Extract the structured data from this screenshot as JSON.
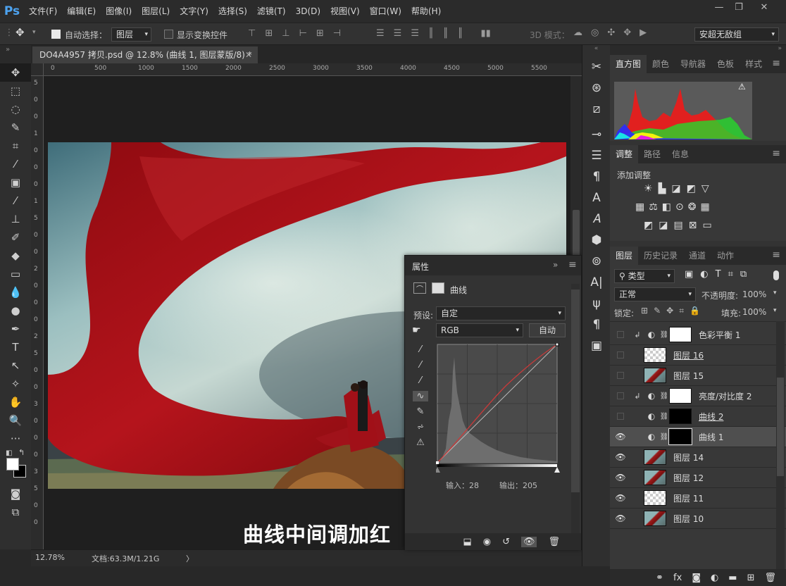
{
  "app": {
    "logo": "Ps",
    "accent": "#4da3f0"
  },
  "menu": [
    "文件(F)",
    "编辑(E)",
    "图像(I)",
    "图层(L)",
    "文字(Y)",
    "选择(S)",
    "滤镜(T)",
    "3D(D)",
    "视图(V)",
    "窗口(W)",
    "帮助(H)"
  ],
  "window_controls": [
    "—",
    "❐",
    "✕"
  ],
  "options": {
    "auto_select_label": "自动选择：",
    "auto_select_target": "图层",
    "show_transform_label": "显示变换控件",
    "mode_3d_label": "3D 模式：",
    "workspace": "安超无敌组"
  },
  "document": {
    "tab_title": "DO4A4957 拷贝.psd @ 12.8% (曲线 1, 图层蒙版/8) *",
    "ruler_labels": [
      "0",
      "500",
      "1000",
      "1500",
      "2000",
      "2500",
      "3000",
      "3500",
      "4000",
      "4500",
      "5000",
      "5500"
    ],
    "vruler_labels": [
      "5",
      "0",
      "0",
      "1",
      "0",
      "0",
      "0",
      "1",
      "5",
      "0",
      "0",
      "2",
      "0",
      "0",
      "0",
      "2",
      "5",
      "0",
      "0",
      "3",
      "0",
      "0",
      "0",
      "3",
      "5",
      "0",
      "0"
    ],
    "caption": "曲线中间调加红"
  },
  "status": {
    "zoom": "12.78%",
    "doc_info": "文档:63.3M/1.21G",
    "arrow": "〉"
  },
  "panels": {
    "histogram_tabs": [
      "直方图",
      "颜色",
      "导航器",
      "色板",
      "样式"
    ],
    "adjust_tabs": [
      "调整",
      "路径",
      "信息"
    ],
    "add_adjustment": "添加调整",
    "layers_tabs": [
      "图层",
      "历史记录",
      "通道",
      "动作"
    ],
    "filter_kind": "类型",
    "blend_mode": "正常",
    "opacity_label": "不透明度:",
    "opacity_value": "100%",
    "lock_label": "锁定:",
    "fill_label": "填充:",
    "fill_value": "100%"
  },
  "layers": [
    {
      "name": "色彩平衡 1",
      "visible": false,
      "clip": true,
      "adj": true,
      "thumb": "white",
      "underline": false
    },
    {
      "name": "图层 16",
      "visible": false,
      "clip": false,
      "adj": false,
      "thumb": "checker",
      "underline": true
    },
    {
      "name": "图层 15",
      "visible": false,
      "clip": false,
      "adj": false,
      "thumb": "photo",
      "underline": false
    },
    {
      "name": "亮度/对比度 2",
      "visible": false,
      "clip": true,
      "adj": true,
      "thumb": "white",
      "underline": false
    },
    {
      "name": "曲线 2",
      "visible": false,
      "clip": false,
      "adj": true,
      "thumb": "black",
      "underline": true
    },
    {
      "name": "曲线 1",
      "visible": true,
      "clip": false,
      "adj": true,
      "thumb": "black",
      "underline": false,
      "selected": true
    },
    {
      "name": "图层 14",
      "visible": true,
      "clip": false,
      "adj": false,
      "thumb": "photo",
      "underline": false
    },
    {
      "name": "图层 12",
      "visible": true,
      "clip": false,
      "adj": false,
      "thumb": "photo",
      "underline": false
    },
    {
      "name": "图层 11",
      "visible": true,
      "clip": false,
      "adj": false,
      "thumb": "checker",
      "underline": false
    },
    {
      "name": "图层 10",
      "visible": true,
      "clip": false,
      "adj": false,
      "thumb": "photo",
      "underline": false
    }
  ],
  "properties": {
    "title": "属性",
    "panel_kind": "曲线",
    "preset_label": "预设:",
    "preset_value": "自定",
    "channel": "RGB",
    "auto_button": "自动",
    "input_label": "输入：28",
    "output_label": "输出：205"
  }
}
